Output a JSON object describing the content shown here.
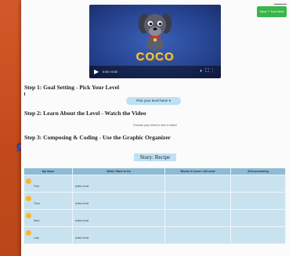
{
  "background": {
    "left_link_text": "d",
    "accent": "#c9541f"
  },
  "header": {
    "corner_button_label": "Save + Turn Next"
  },
  "video": {
    "title": "COCO",
    "time_display": "0:00 / 0:00",
    "play_icon": "play-icon",
    "controls_icons": [
      "volume-icon",
      "fullscreen-icon",
      "more-icon"
    ]
  },
  "steps": [
    {
      "label": "Step 1: Goal Setting - Pick Your Level"
    },
    {
      "label": "Step 2: Learn About the Level - Watch the Video"
    },
    {
      "label": "Step 3: Composing & Coding - Use the Graphic Organizer"
    }
  ],
  "level_picker": {
    "label": "Pick your level here! ▾"
  },
  "video_hint": "Choose your level to see a video!",
  "story": {
    "label": "Story: Recipe"
  },
  "organizer": {
    "columns": [
      "My Ideas",
      "What I Want to Do",
      "Blocks & Icons I will need",
      "Self-monitoring"
    ],
    "rows": [
      {
        "order": "First",
        "want": "select level"
      },
      {
        "order": "Then",
        "want": "select level"
      },
      {
        "order": "Next",
        "want": "select level"
      },
      {
        "order": "Last",
        "want": "select level"
      }
    ]
  },
  "colors": {
    "table_header": "#8dbbd4",
    "table_cell": "#c9e2ef",
    "pill": "#bfe0f5",
    "video_bg": "#2f56a8"
  }
}
